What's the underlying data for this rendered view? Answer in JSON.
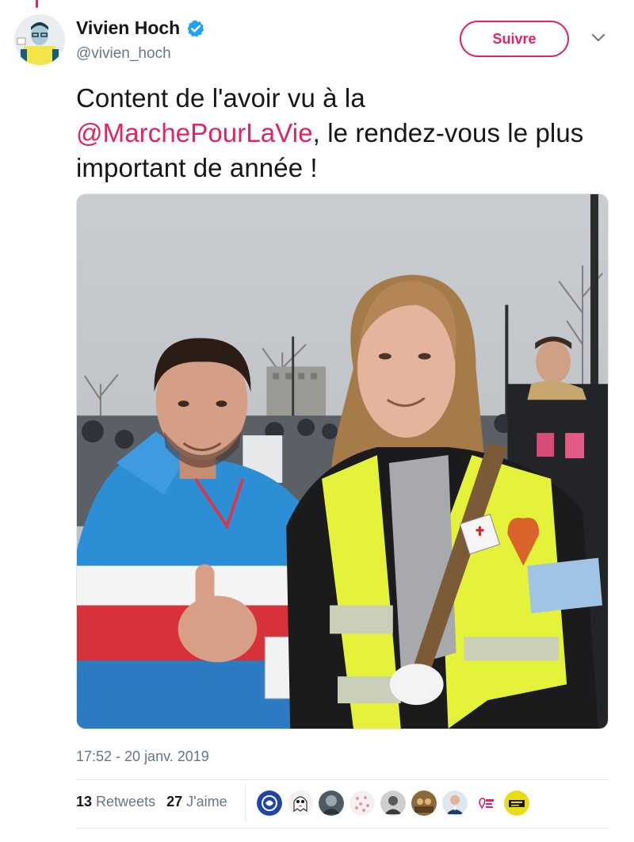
{
  "tweet": {
    "author": {
      "display_name": "Vivien Hoch",
      "handle": "@vivien_hoch",
      "verified": true
    },
    "follow_label": "Suivre",
    "text_before": "Content de l'avoir vu à la ",
    "mention": "@MarchePourLaVie",
    "text_after": ", le rendez-vous le plus important de année !",
    "timestamp": "17:52 - 20 janv. 2019",
    "retweets": {
      "count": "13",
      "label": "Retweets"
    },
    "likes": {
      "count": "27",
      "label": "J'aime"
    }
  },
  "colors": {
    "accent": "#e0245e",
    "verified": "#1da1f2",
    "secondary_text": "#657786",
    "divider": "#e1e8ed"
  },
  "icons": {
    "verified": "verified-badge-icon",
    "menu": "chevron-down-icon"
  },
  "liker_avatars": [
    {
      "icon": "blue-logo-avatar"
    },
    {
      "icon": "ghost-avatar"
    },
    {
      "icon": "dark-portrait-avatar"
    },
    {
      "icon": "pink-pattern-avatar"
    },
    {
      "icon": "grayscale-portrait-avatar"
    },
    {
      "icon": "crowd-photo-avatar"
    },
    {
      "icon": "suit-portrait-avatar"
    },
    {
      "icon": "marche-logo-avatar"
    },
    {
      "icon": "yellow-badge-avatar"
    }
  ]
}
